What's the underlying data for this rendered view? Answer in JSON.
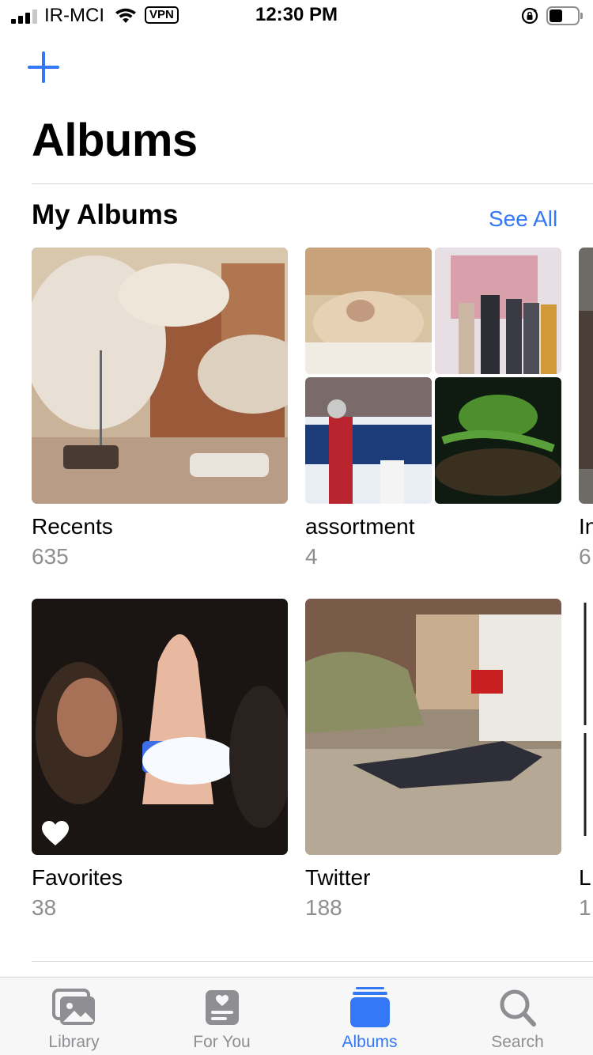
{
  "status_bar": {
    "carrier": "IR-MCI",
    "vpn": "VPN",
    "time": "12:30 PM"
  },
  "header": {
    "title": "Albums",
    "add_icon": "plus-icon"
  },
  "my_albums": {
    "title": "My Albums",
    "see_all": "See All",
    "albums": [
      {
        "name": "Recents",
        "count": "635"
      },
      {
        "name": "assortment",
        "count": "4"
      },
      {
        "name": "In",
        "count": "6"
      },
      {
        "name": "Favorites",
        "count": "38"
      },
      {
        "name": "Twitter",
        "count": "188"
      },
      {
        "name": "L",
        "count": "1"
      }
    ]
  },
  "tab_bar": {
    "tabs": [
      {
        "label": "Library",
        "icon": "photos-stack-icon",
        "active": false
      },
      {
        "label": "For You",
        "icon": "for-you-icon",
        "active": false
      },
      {
        "label": "Albums",
        "icon": "albums-stack-icon",
        "active": true
      },
      {
        "label": "Search",
        "icon": "search-icon",
        "active": false
      }
    ]
  },
  "colors": {
    "accent": "#3478f6",
    "secondary_text": "#8e8e93",
    "tab_inactive": "#8e8e93"
  }
}
